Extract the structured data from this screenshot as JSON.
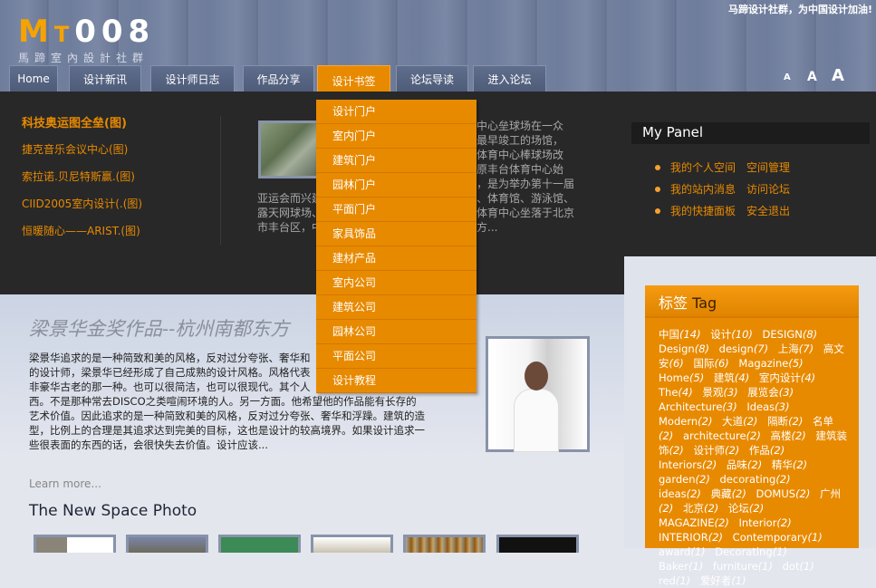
{
  "header": {
    "slogan": "马蹄设计社群，为中国设计加油!",
    "logo_text": "MT008",
    "logo_sub": "馬蹄室內設計社群",
    "nav": [
      "Home",
      "设计新讯",
      "设计师日志",
      "作品分享",
      "设计书签",
      "论坛导读",
      "进入论坛"
    ],
    "font_sizes": [
      "A",
      "A",
      "A"
    ]
  },
  "dropdown": [
    "设计门户",
    "室内门户",
    "建筑门户",
    "园林门户",
    "平面门户",
    "家具饰品",
    "建材产品",
    "室内公司",
    "建筑公司",
    "园林公司",
    "平面公司",
    "设计教程"
  ],
  "featured": {
    "heading": "科技奥运图全垒(图)",
    "items": [
      "捷克音乐会议中心(图)",
      "索拉诺.贝尼特斯赢.(图)",
      "CIID2005室内设计(.(图)",
      "恒暖随心——ARIST.(图)"
    ]
  },
  "news": {
    "right_lines": [
      "中心垒球场在一众",
      "最早竣工的场馆，",
      "体育中心棒球场改",
      "原丰台体育中心始",
      "，是为举办第十一届",
      "、体育馆、游泳馆、",
      "体育中心坐落于北京",
      "方..."
    ],
    "left_lines": [
      "亚运会而兴建",
      "露天网球场、",
      "市丰台区，中"
    ]
  },
  "panel": {
    "title": "My Panel",
    "items": [
      [
        "我的个人空间",
        "空间管理"
      ],
      [
        "我的站内消息",
        "访问论坛"
      ],
      [
        "我的快捷面板",
        "安全退出"
      ]
    ]
  },
  "article": {
    "title": "梁景华金奖作品--杭州南都东方",
    "lines": [
      "梁景华追求的是一种简致和美的风格，反对过分夸张、奢华和",
      "的设计师，梁景华已经形成了自己成熟的设计风格。风格代表",
      "非豪华古老的那一种。也可以很简洁，也可以很现代。其个人",
      "西。不是那种常去DISCO之类喧闹环境的人。另一方面。他希望他的作品能有长存的",
      "艺术价值。因此追求的是一种简致和美的风格，反对过分夸张、奢华和浮躁。建筑的造",
      "型，比例上的合理是其追求达到完美的目标，这也是设计的较高境界。如果设计追求一",
      "些很表面的东西的话，会很快失去价值。设计应该..."
    ],
    "learn_more": "Learn more..."
  },
  "photos": {
    "heading": "The New Space Photo"
  },
  "tags": {
    "title_cn": "标签",
    "title_en": "Tag",
    "items": [
      [
        "中国",
        "(14)"
      ],
      [
        "设计",
        "(10)"
      ],
      [
        "DESIGN",
        "(8)"
      ],
      [
        "Design",
        "(8)"
      ],
      [
        "design",
        "(7)"
      ],
      [
        "上海",
        "(7)"
      ],
      [
        "高文安",
        "(6)"
      ],
      [
        "国际",
        "(6)"
      ],
      [
        "Magazine",
        "(5)"
      ],
      [
        "Home",
        "(5)"
      ],
      [
        "建筑",
        "(4)"
      ],
      [
        "室内设计",
        "(4)"
      ],
      [
        "The",
        "(4)"
      ],
      [
        "景观",
        "(3)"
      ],
      [
        "展览会",
        "(3)"
      ],
      [
        "Architecture",
        "(3)"
      ],
      [
        "Ideas",
        "(3)"
      ],
      [
        "Modern",
        "(2)"
      ],
      [
        "大道",
        "(2)"
      ],
      [
        "隔断",
        "(2)"
      ],
      [
        "名单",
        "(2)"
      ],
      [
        "architecture",
        "(2)"
      ],
      [
        "高楼",
        "(2)"
      ],
      [
        "建筑装饰",
        "(2)"
      ],
      [
        "设计师",
        "(2)"
      ],
      [
        "作品",
        "(2)"
      ],
      [
        "Interiors",
        "(2)"
      ],
      [
        "品味",
        "(2)"
      ],
      [
        "精华",
        "(2)"
      ],
      [
        "garden",
        "(2)"
      ],
      [
        "decorating",
        "(2)"
      ],
      [
        "ideas",
        "(2)"
      ],
      [
        "典藏",
        "(2)"
      ],
      [
        "DOMUS",
        "(2)"
      ],
      [
        "广州",
        "(2)"
      ],
      [
        "北京",
        "(2)"
      ],
      [
        "论坛",
        "(2)"
      ],
      [
        "MAGAZINE",
        "(2)"
      ],
      [
        "Interior",
        "(2)"
      ],
      [
        "INTERIOR",
        "(2)"
      ],
      [
        "Contemporary",
        "(1)"
      ],
      [
        "award",
        "(1)"
      ],
      [
        "Decorating",
        "(1)"
      ],
      [
        "Baker",
        "(1)"
      ],
      [
        "furniture",
        "(1)"
      ],
      [
        "dot",
        "(1)"
      ],
      [
        "red",
        "(1)"
      ],
      [
        "爱好者",
        "(1)"
      ]
    ]
  },
  "colors": {
    "accent": "#e88a00",
    "dark": "#282828",
    "header": "#6f7d9c"
  }
}
